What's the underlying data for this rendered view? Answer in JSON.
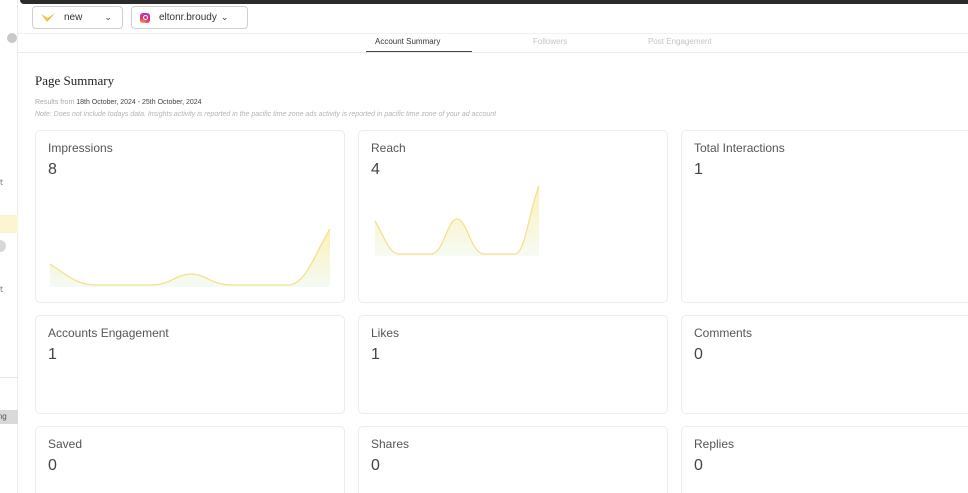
{
  "header": {
    "workspace_select": {
      "value": "new"
    },
    "account_select": {
      "value": "eltonr.broudy"
    }
  },
  "sidebar": {
    "clipped_label": "ing"
  },
  "tabs": [
    {
      "label": "Account Summary",
      "active": true
    },
    {
      "label": "Followers",
      "active": false
    },
    {
      "label": "Post Engagement",
      "active": false
    }
  ],
  "summary": {
    "title": "Page Summary",
    "results_prefix": "Results from ",
    "date_range": "18th October, 2024 - 25th October, 2024",
    "note": "Note: Does not include todays data. Insights activity is reported in the pacific time zone ads activity is reported in pacific time zone of your ad account"
  },
  "metrics": [
    {
      "label": "Impressions",
      "value": "8"
    },
    {
      "label": "Reach",
      "value": "4"
    },
    {
      "label": "Total Interactions",
      "value": "1"
    },
    {
      "label": "Accounts Engagement",
      "value": "1"
    },
    {
      "label": "Likes",
      "value": "1"
    },
    {
      "label": "Comments",
      "value": "0"
    },
    {
      "label": "Saved",
      "value": "0"
    },
    {
      "label": "Shares",
      "value": "0"
    },
    {
      "label": "Replies",
      "value": "0"
    }
  ],
  "colors": {
    "accent": "#f7d36b",
    "spark_fill": "#fdf3c4"
  }
}
